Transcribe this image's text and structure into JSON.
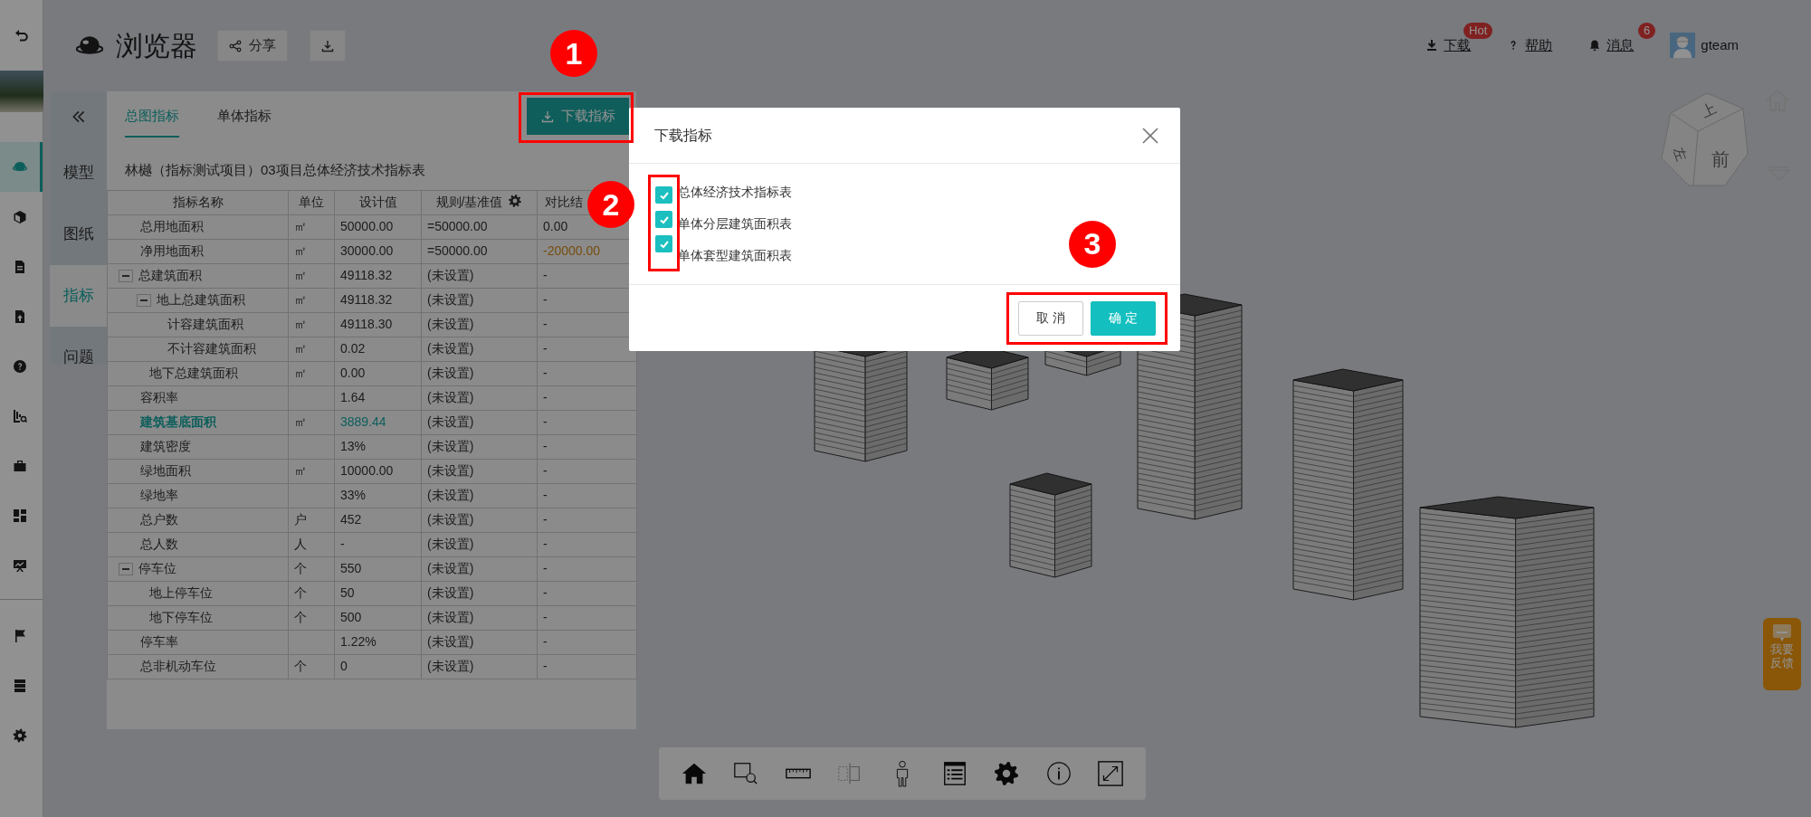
{
  "rail": {
    "items": [
      {
        "selected": true
      },
      {
        "selected": false
      },
      {
        "selected": false
      },
      {
        "selected": false
      },
      {
        "selected": false
      },
      {
        "selected": false
      },
      {
        "selected": false
      },
      {
        "selected": false
      },
      {
        "selected": false
      },
      {
        "selected": false
      },
      {
        "selected": false
      },
      {
        "selected": false
      }
    ]
  },
  "header": {
    "title": "浏览器",
    "share_label": "分享",
    "links": [
      {
        "label": "下载",
        "badge": "Hot"
      },
      {
        "label": "帮助"
      },
      {
        "label": "消息",
        "badge": "6"
      }
    ],
    "user": "gteam"
  },
  "panel": {
    "tabs": [
      {
        "label": "模型",
        "selected": false
      },
      {
        "label": "图纸",
        "selected": false
      },
      {
        "label": "指标",
        "selected": true
      },
      {
        "label": "问题",
        "selected": false
      }
    ],
    "subtabs": [
      {
        "label": "总图指标",
        "selected": true
      },
      {
        "label": "单体指标",
        "selected": false
      }
    ],
    "download_button": "下载指标",
    "table_title": "林樾（指标测试项目）03项目总体经济技术指标表",
    "table": {
      "columns": [
        "指标名称",
        "单位",
        "设计值",
        "规则/基准值",
        "对比结"
      ],
      "rows": [
        {
          "name": "总用地面积",
          "unit": "㎡",
          "design": "50000.00",
          "rule": "=50000.00",
          "compare": "0.00",
          "highlighted": false,
          "warning": false
        },
        {
          "name": "净用地面积",
          "unit": "㎡",
          "design": "30000.00",
          "rule": "=50000.00",
          "compare": "-20000.00",
          "highlighted": false,
          "warning": true
        },
        {
          "name": "总建筑面积",
          "unit": "㎡",
          "design": "49118.32",
          "rule": "(未设置)",
          "compare": "-",
          "highlighted": false,
          "warning": false,
          "expanded": true,
          "children": [
            {
              "name": "地上总建筑面积",
              "unit": "㎡",
              "design": "49118.32",
              "rule": "(未设置)",
              "compare": "-",
              "highlighted": false,
              "warning": false,
              "expanded": true,
              "children": [
                {
                  "name": "计容建筑面积",
                  "unit": "㎡",
                  "design": "49118.30",
                  "rule": "(未设置)",
                  "compare": "-",
                  "highlighted": false,
                  "warning": false
                },
                {
                  "name": "不计容建筑面积",
                  "unit": "㎡",
                  "design": "0.02",
                  "rule": "(未设置)",
                  "compare": "-",
                  "highlighted": false,
                  "warning": false
                }
              ]
            },
            {
              "name": "地下总建筑面积",
              "unit": "㎡",
              "design": "0.00",
              "rule": "(未设置)",
              "compare": "-",
              "highlighted": false,
              "warning": false
            }
          ]
        },
        {
          "name": "容积率",
          "unit": "",
          "design": "1.64",
          "rule": "(未设置)",
          "compare": "-",
          "highlighted": false,
          "warning": false
        },
        {
          "name": "建筑基底面积",
          "unit": "㎡",
          "design": "3889.44",
          "rule": "(未设置)",
          "compare": "-",
          "highlighted": true,
          "warning": false
        },
        {
          "name": "建筑密度",
          "unit": "",
          "design": "13%",
          "rule": "(未设置)",
          "compare": "-",
          "highlighted": false,
          "warning": false
        },
        {
          "name": "绿地面积",
          "unit": "㎡",
          "design": "10000.00",
          "rule": "(未设置)",
          "compare": "-",
          "highlighted": false,
          "warning": false
        },
        {
          "name": "绿地率",
          "unit": "",
          "design": "33%",
          "rule": "(未设置)",
          "compare": "-",
          "highlighted": false,
          "warning": false
        },
        {
          "name": "总户数",
          "unit": "户",
          "design": "452",
          "rule": "(未设置)",
          "compare": "-",
          "highlighted": false,
          "warning": false
        },
        {
          "name": "总人数",
          "unit": "人",
          "design": "-",
          "rule": "(未设置)",
          "compare": "-",
          "highlighted": false,
          "warning": false
        },
        {
          "name": "停车位",
          "unit": "个",
          "design": "550",
          "rule": "(未设置)",
          "compare": "-",
          "highlighted": false,
          "warning": false,
          "expanded": true,
          "children": [
            {
              "name": "地上停车位",
              "unit": "个",
              "design": "50",
              "rule": "(未设置)",
              "compare": "-",
              "highlighted": false,
              "warning": false
            },
            {
              "name": "地下停车位",
              "unit": "个",
              "design": "500",
              "rule": "(未设置)",
              "compare": "-",
              "highlighted": false,
              "warning": false
            }
          ]
        },
        {
          "name": "停车率",
          "unit": "",
          "design": "1.22%",
          "rule": "(未设置)",
          "compare": "-",
          "highlighted": false,
          "warning": false
        },
        {
          "name": "总非机动车位",
          "unit": "个",
          "design": "0",
          "rule": "(未设置)",
          "compare": "-",
          "highlighted": false,
          "warning": false
        }
      ]
    }
  },
  "viewcube": {
    "faces": [
      "上",
      "左",
      "前"
    ]
  },
  "feedback": "我要反馈",
  "toolbar": {
    "items": [
      {
        "disabled": false
      },
      {
        "disabled": false
      },
      {
        "disabled": false
      },
      {
        "disabled": true
      },
      {
        "disabled": false
      },
      {
        "disabled": false
      },
      {
        "disabled": false
      },
      {
        "disabled": false
      },
      {
        "disabled": false
      }
    ]
  },
  "dialog": {
    "title": "下载指标",
    "options": [
      {
        "label": "总体经济技术指标表",
        "checked": true
      },
      {
        "label": "单体分层建筑面积表",
        "checked": true
      },
      {
        "label": "单体套型建筑面积表",
        "checked": true
      }
    ],
    "buttons": [
      {
        "label": "取 消",
        "kind": "secondary"
      },
      {
        "label": "确 定",
        "kind": "primary"
      }
    ]
  },
  "annotations": [
    {
      "label": "1"
    },
    {
      "label": "2"
    },
    {
      "label": "3"
    }
  ]
}
